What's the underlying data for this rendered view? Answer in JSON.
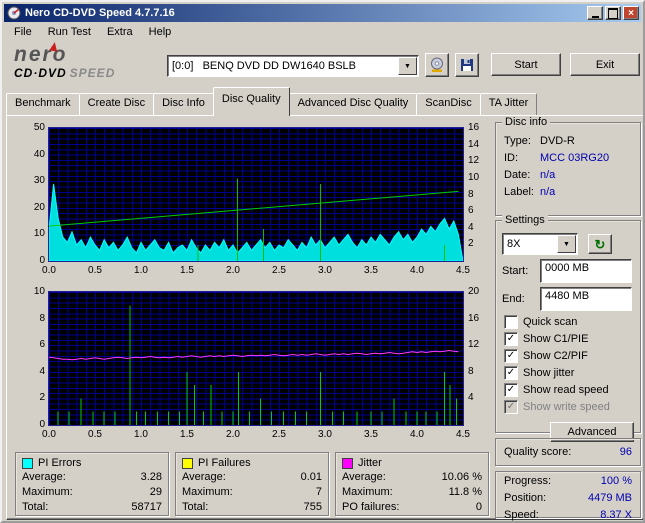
{
  "window": {
    "title": "Nero CD-DVD Speed 4.7.7.16",
    "close_glyph": "×"
  },
  "menu": {
    "items": [
      "File",
      "Run Test",
      "Extra",
      "Help"
    ]
  },
  "logo": {
    "brand": "nero",
    "product_a": "CD·DVD",
    "product_b": "SPEED"
  },
  "toolbar": {
    "drive_value": "[0:0]   BENQ DVD DD DW1640 BSLB",
    "start_button": "Start",
    "exit_button": "Exit"
  },
  "tabs": {
    "active": "Disc Quality",
    "items": [
      "Benchmark",
      "Create Disc",
      "Disc Info",
      "Disc Quality",
      "Advanced Disc Quality",
      "ScanDisc",
      "TA Jitter"
    ]
  },
  "disc_info": {
    "title": "Disc info",
    "rows": [
      {
        "label": "Type:",
        "value": "DVD-R"
      },
      {
        "label": "ID:",
        "value": "MCC 03RG20"
      },
      {
        "label": "Date:",
        "value": "n/a"
      },
      {
        "label": "Label:",
        "value": "n/a"
      }
    ]
  },
  "settings": {
    "title": "Settings",
    "speed_value": "8X",
    "start_label": "Start:",
    "start_value": "0000 MB",
    "end_label": "End:",
    "end_value": "4480 MB",
    "checkboxes": [
      {
        "label": "Quick scan",
        "checked": false,
        "disabled": false
      },
      {
        "label": "Show C1/PIE",
        "checked": true,
        "disabled": false
      },
      {
        "label": "Show C2/PIF",
        "checked": true,
        "disabled": false
      },
      {
        "label": "Show jitter",
        "checked": true,
        "disabled": false
      },
      {
        "label": "Show read speed",
        "checked": true,
        "disabled": false
      },
      {
        "label": "Show write speed",
        "checked": true,
        "disabled": true
      }
    ],
    "advanced_button": "Advanced"
  },
  "quality": {
    "label": "Quality score:",
    "value": "96"
  },
  "progress": {
    "rows": [
      {
        "label": "Progress:",
        "value": "100 %"
      },
      {
        "label": "Position:",
        "value": "4479 MB"
      },
      {
        "label": "Speed:",
        "value": "8.37 X"
      }
    ]
  },
  "stats": {
    "pi_errors": {
      "title": "PI Errors",
      "color": "#00ffff",
      "rows": [
        {
          "label": "Average:",
          "value": "3.28"
        },
        {
          "label": "Maximum:",
          "value": "29"
        },
        {
          "label": "Total:",
          "value": "58717"
        }
      ]
    },
    "pi_failures": {
      "title": "PI Failures",
      "color": "#ffff00",
      "rows": [
        {
          "label": "Average:",
          "value": "0.01"
        },
        {
          "label": "Maximum:",
          "value": "7"
        },
        {
          "label": "Total:",
          "value": "755"
        }
      ]
    },
    "jitter": {
      "title": "Jitter",
      "color": "#ff00ff",
      "rows": [
        {
          "label": "Average:",
          "value": "10.06 %"
        },
        {
          "label": "Maximum:",
          "value": "11.8 %"
        },
        {
          "label": "PO failures:",
          "value": "0"
        }
      ]
    }
  },
  "chart_data": [
    {
      "type": "area",
      "name": "PI Errors and read speed vs disc position (GB)",
      "xmin": 0,
      "xmax": 4.5,
      "x_ticks": [
        0,
        0.5,
        1,
        1.5,
        2,
        2.5,
        3,
        3.5,
        4,
        4.5
      ],
      "y_left": {
        "min": 0,
        "max": 50,
        "ticks": [
          0,
          10,
          20,
          30,
          40,
          50
        ]
      },
      "y_right": {
        "min": 0,
        "max": 16,
        "ticks": [
          2,
          4,
          6,
          8,
          10,
          12,
          14,
          16
        ]
      },
      "series": [
        {
          "name": "PI Errors",
          "type": "area",
          "axis": "left",
          "color": "#00dede",
          "stroke": "#00ffff",
          "x0": 0,
          "dx": 0.05,
          "values": [
            12,
            29,
            16,
            9,
            7,
            11,
            6,
            8,
            5,
            9,
            6,
            4,
            8,
            5,
            7,
            4,
            6,
            9,
            5,
            3,
            7,
            4,
            6,
            8,
            5,
            4,
            7,
            3,
            5,
            6,
            4,
            8,
            5,
            3,
            6,
            4,
            7,
            5,
            8,
            4,
            6,
            3,
            5,
            7,
            4,
            6,
            8,
            5,
            7,
            4,
            6,
            5,
            8,
            6,
            4,
            7,
            5,
            9,
            6,
            8,
            5,
            7,
            9,
            6,
            8,
            10,
            7,
            5,
            8,
            6,
            9,
            7,
            10,
            8,
            6,
            9,
            11,
            8,
            10,
            7,
            9,
            12,
            10,
            13,
            11,
            14,
            16,
            12,
            15,
            10
          ]
        },
        {
          "name": "Error spikes",
          "type": "spikes",
          "axis": "left",
          "color": "#00c000",
          "points": [
            [
              1.62,
              6
            ],
            [
              2.05,
              31
            ],
            [
              2.33,
              12
            ],
            [
              2.95,
              29
            ],
            [
              4.3,
              6
            ]
          ]
        },
        {
          "name": "Read speed",
          "type": "line",
          "axis": "right",
          "color": "#00cc00",
          "x0": 0,
          "dx": 4.45,
          "values": [
            4.2,
            8.37
          ]
        }
      ]
    },
    {
      "type": "spikes",
      "name": "PI Failures and jitter vs disc position (GB)",
      "xmin": 0,
      "xmax": 4.5,
      "x_ticks": [
        0,
        0.5,
        1,
        1.5,
        2,
        2.5,
        3,
        3.5,
        4,
        4.5
      ],
      "y_left": {
        "min": 0,
        "max": 10,
        "ticks": [
          0,
          2,
          4,
          6,
          8,
          10
        ]
      },
      "y_right": {
        "min": 0,
        "max": 20,
        "ticks": [
          4,
          8,
          12,
          16,
          20
        ]
      },
      "series": [
        {
          "name": "PI Failures",
          "type": "spikes",
          "axis": "left",
          "color": "#00d000",
          "points": [
            [
              0.1,
              1
            ],
            [
              0.22,
              1
            ],
            [
              0.35,
              2
            ],
            [
              0.48,
              1
            ],
            [
              0.6,
              1
            ],
            [
              0.72,
              1
            ],
            [
              0.88,
              9
            ],
            [
              0.95,
              1
            ],
            [
              1.05,
              1
            ],
            [
              1.18,
              1
            ],
            [
              1.3,
              1
            ],
            [
              1.42,
              1
            ],
            [
              1.5,
              4
            ],
            [
              1.58,
              3
            ],
            [
              1.68,
              1
            ],
            [
              1.76,
              3
            ],
            [
              1.88,
              1
            ],
            [
              2.0,
              1
            ],
            [
              2.06,
              4
            ],
            [
              2.18,
              1
            ],
            [
              2.3,
              2
            ],
            [
              2.42,
              1
            ],
            [
              2.55,
              1
            ],
            [
              2.68,
              1
            ],
            [
              2.8,
              1
            ],
            [
              2.95,
              4
            ],
            [
              3.08,
              1
            ],
            [
              3.2,
              1
            ],
            [
              3.35,
              1
            ],
            [
              3.5,
              1
            ],
            [
              3.62,
              1
            ],
            [
              3.75,
              2
            ],
            [
              3.88,
              1
            ],
            [
              4.0,
              1
            ],
            [
              4.1,
              1
            ],
            [
              4.22,
              1
            ],
            [
              4.3,
              4
            ],
            [
              4.36,
              3
            ],
            [
              4.43,
              2
            ]
          ]
        },
        {
          "name": "Jitter",
          "type": "line",
          "axis": "right",
          "color": "#ff38ff",
          "x0": 0,
          "dx": 0.05,
          "values": [
            10.2,
            10.1,
            10.0,
            9.9,
            9.9,
            9.8,
            9.9,
            10.0,
            9.9,
            10.0,
            10.1,
            10.0,
            9.9,
            10.0,
            10.1,
            10.2,
            10.1,
            10.0,
            10.1,
            10.2,
            10.1,
            10.2,
            10.3,
            10.2,
            10.1,
            10.2,
            10.1,
            10.2,
            10.3,
            10.2,
            10.3,
            10.4,
            10.3,
            10.2,
            10.3,
            10.4,
            10.3,
            10.4,
            10.3,
            10.4,
            10.5,
            10.4,
            10.3,
            10.4,
            10.5,
            10.4,
            10.5,
            10.4,
            10.5,
            10.6,
            10.5,
            10.4,
            10.5,
            10.6,
            10.5,
            10.6,
            10.5,
            10.6,
            10.7,
            10.6,
            10.5,
            10.6,
            10.7,
            10.6,
            10.7,
            10.6,
            10.7,
            10.8,
            10.7,
            10.6,
            10.7,
            10.8,
            10.7,
            10.8,
            10.9,
            10.8,
            10.7,
            10.8,
            10.9,
            11.0,
            10.9,
            11.0,
            10.9,
            11.0,
            11.1,
            11.0,
            11.1,
            11.2,
            11.1,
            11.0
          ]
        }
      ]
    }
  ]
}
